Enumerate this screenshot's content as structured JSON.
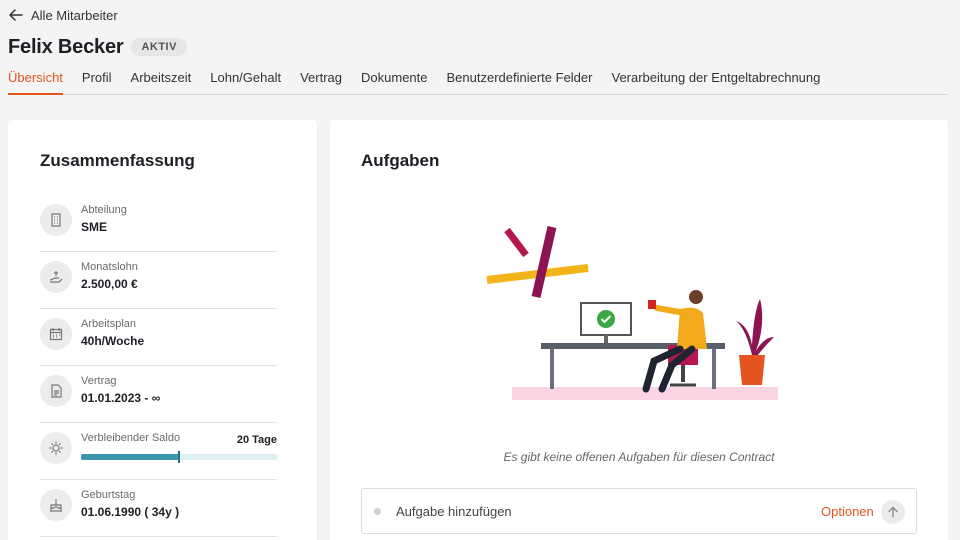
{
  "back": {
    "label": "Alle Mitarbeiter",
    "icon": "arrow-left-icon"
  },
  "employee": {
    "name": "Felix Becker",
    "status": "AKTIV"
  },
  "tabs": [
    {
      "label": "Übersicht",
      "active": true
    },
    {
      "label": "Profil"
    },
    {
      "label": "Arbeitszeit"
    },
    {
      "label": "Lohn/Gehalt"
    },
    {
      "label": "Vertrag"
    },
    {
      "label": "Dokumente"
    },
    {
      "label": "Benutzerdefinierte Felder"
    },
    {
      "label": "Verarbeitung der Entgeltabrechnung"
    }
  ],
  "summary": {
    "title": "Zusammenfassung",
    "items": [
      {
        "label": "Abteilung",
        "value": "SME",
        "icon": "building-icon"
      },
      {
        "label": "Monatslohn",
        "value": "2.500,00 €",
        "icon": "salary-icon"
      },
      {
        "label": "Arbeitsplan",
        "value": "40h/Woche",
        "icon": "calendar-icon"
      },
      {
        "label": "Vertrag",
        "value": "01.01.2023 - ∞",
        "icon": "document-icon"
      },
      {
        "label": "Verbleibender Saldo",
        "value": "20 Tage",
        "icon": "sun-icon",
        "progress": 0.5
      },
      {
        "label": "Geburtstag",
        "value": "01.06.1990 ( 34y )",
        "icon": "cake-icon"
      }
    ]
  },
  "tasks": {
    "title": "Aufgaben",
    "empty_text": "Es gibt keine offenen Aufgaben für diesen Contract",
    "add_placeholder": "Aufgabe hinzufügen",
    "options_label": "Optionen",
    "send_icon": "arrow-up-icon"
  },
  "colors": {
    "accent": "#e3541f",
    "progress": "#3b97ad",
    "badge_bg": "#e6e6e6"
  }
}
